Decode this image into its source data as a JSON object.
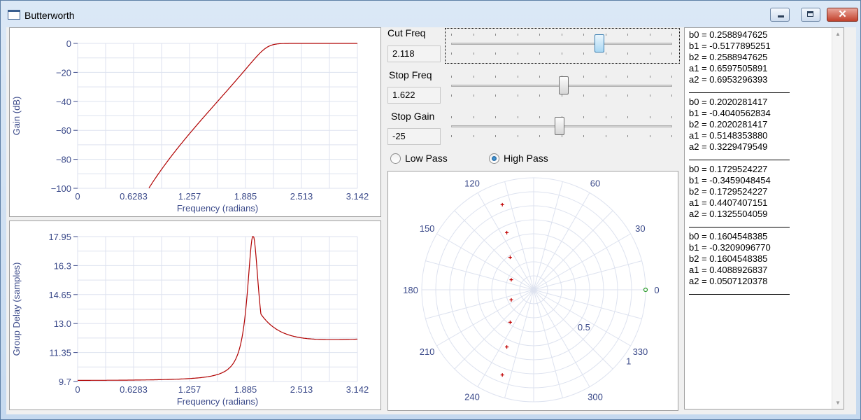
{
  "window": {
    "title": "Butterworth",
    "close_glyph": "✕"
  },
  "gain_plot": {
    "ylabel": "Gain (dB)",
    "xlabel": "Frequency (radians)",
    "yticks": [
      "0",
      "−20",
      "−40",
      "−60",
      "−80",
      "−100"
    ],
    "xticks": [
      "0",
      "0.6283",
      "1.257",
      "1.885",
      "2.513",
      "3.142"
    ]
  },
  "delay_plot": {
    "ylabel": "Group Delay (samples)",
    "xlabel": "Frequency (radians)",
    "yticks": [
      "17.95",
      "16.3",
      "14.65",
      "13.0",
      "11.35",
      "9.7"
    ],
    "xticks": [
      "0",
      "0.6283",
      "1.257",
      "1.885",
      "2.513",
      "3.142"
    ]
  },
  "controls": {
    "cut_freq": {
      "label": "Cut Freq",
      "value": "2.118",
      "slider_fraction": 0.67
    },
    "stop_freq": {
      "label": "Stop Freq",
      "value": "1.622",
      "slider_fraction": 0.51
    },
    "stop_gain": {
      "label": "Stop Gain",
      "value": "-25",
      "slider_fraction": 0.49
    },
    "low_pass": {
      "label": "Low Pass",
      "selected": false
    },
    "high_pass": {
      "label": "High Pass",
      "selected": true
    }
  },
  "polar_plot": {
    "angle_labels": [
      "0",
      "30",
      "60",
      "120",
      "150",
      "180",
      "210",
      "240",
      "300",
      "330"
    ],
    "radius_labels": [
      "0.5",
      "1"
    ],
    "poles": [
      [
        -0.28,
        0.76
      ],
      [
        -0.24,
        0.51
      ],
      [
        -0.21,
        0.29
      ],
      [
        -0.2,
        0.09
      ],
      [
        -0.2,
        -0.09
      ],
      [
        -0.21,
        -0.29
      ],
      [
        -0.24,
        -0.51
      ],
      [
        -0.28,
        -0.76
      ]
    ],
    "zeros": [
      [
        1.0,
        0.0
      ]
    ]
  },
  "coefficients": [
    [
      "b0 = 0.2588947625",
      "b1 = -0.5177895251",
      "b2 = 0.2588947625",
      "a1 = 0.6597505891",
      "a2 = 0.6953296393"
    ],
    [
      "b0 = 0.2020281417",
      "b1 = -0.4040562834",
      "b2 = 0.2020281417",
      "a1 = 0.5148353880",
      "a2 = 0.3229479549"
    ],
    [
      "b0 = 0.1729524227",
      "b1 = -0.3459048454",
      "b2 = 0.1729524227",
      "a1 = 0.4407407151",
      "a2 = 0.1325504059"
    ],
    [
      "b0 = 0.1604548385",
      "b1 = -0.3209096770",
      "b2 = 0.1604548385",
      "a1 = 0.4088926837",
      "a2 = 0.0507120378"
    ]
  ],
  "colors": {
    "curve": "#b00000",
    "grid": "#dde2ef",
    "axis_text": "#3b4a8a",
    "pole": "#c00000",
    "zero": "#2a9a2a"
  }
}
